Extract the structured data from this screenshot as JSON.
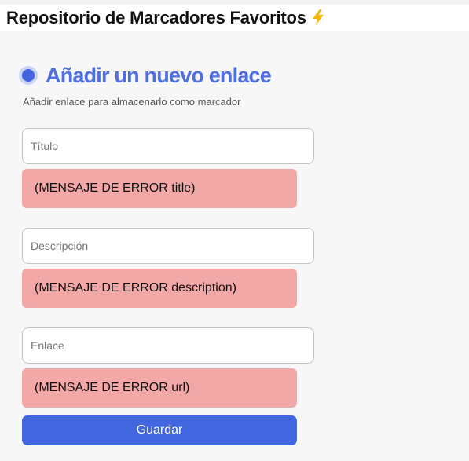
{
  "header": {
    "title": "Repositorio de Marcadores Favoritos",
    "icon": "lightning-bolt-icon",
    "icon_color": "#f5b800"
  },
  "form": {
    "title": "Añadir un nuevo enlace",
    "subtitle": "Añadir enlace para almacenarlo como marcador",
    "accent_color": "#4166e0",
    "fields": [
      {
        "name": "title",
        "value": "",
        "placeholder": "Título",
        "error": "(MENSAJE DE ERROR title)"
      },
      {
        "name": "description",
        "value": "",
        "placeholder": "Descripción",
        "error": "(MENSAJE DE ERROR description)"
      },
      {
        "name": "url",
        "value": "",
        "placeholder": "Enlace",
        "error": "(MENSAJE DE ERROR url)"
      }
    ],
    "submit_label": "Guardar",
    "error_color": "#f3a8a8"
  }
}
